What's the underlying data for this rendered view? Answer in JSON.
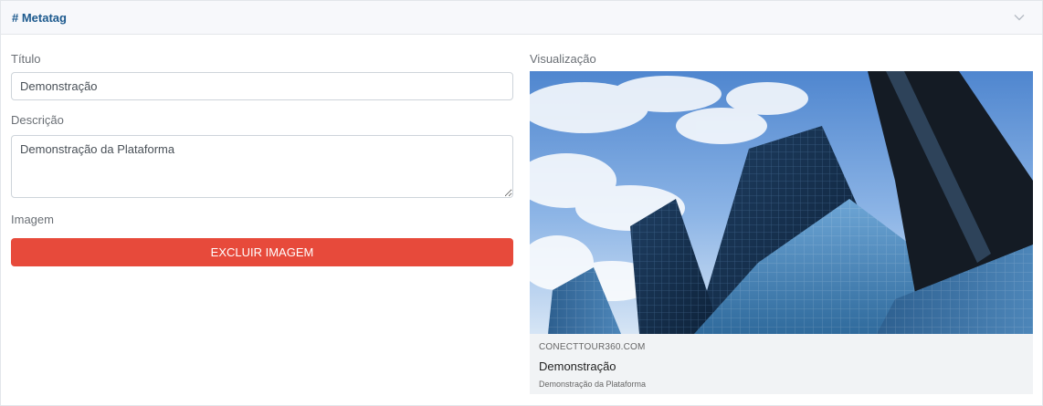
{
  "header": {
    "title": "# Metatag"
  },
  "form": {
    "title_label": "Título",
    "title_value": "Demonstração",
    "description_label": "Descrição",
    "description_value": "Demonstração da Plataforma",
    "image_label": "Imagem",
    "delete_button_label": "EXCLUIR IMAGEM"
  },
  "preview": {
    "label": "Visualização",
    "domain": "CONECTTOUR360.COM",
    "title": "Demonstração",
    "description": "Demonstração da Plataforma"
  },
  "icons": {
    "collapse": "chevron-down-icon",
    "image": "building-photo"
  },
  "colors": {
    "header_title": "#1d5a8e",
    "delete_button": "#e74a3b"
  }
}
